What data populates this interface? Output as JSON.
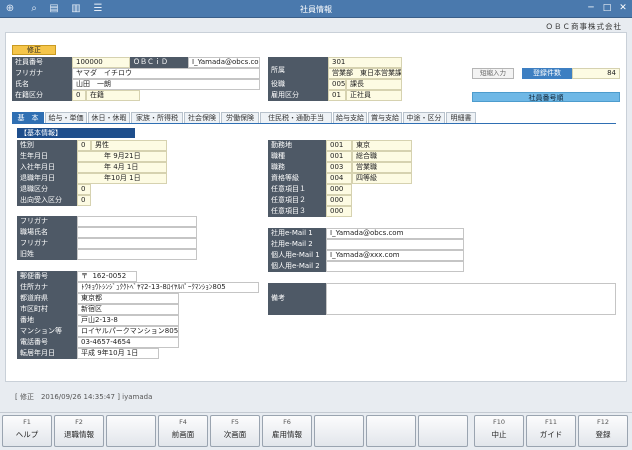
{
  "window": {
    "title": "社員情報",
    "company": "ＯＢＣ商事株式会社"
  },
  "mode": "修正",
  "top": {
    "emp_no_label": "社員番号",
    "emp_no": "100000",
    "obcid_label": "ＯＢＣｉＤ",
    "obcid": "I_Yamada@obcs.co",
    "furigana_label": "フリガナ",
    "furigana": "ヤマダ　イチロウ",
    "name_label": "氏名",
    "name": "山田　一朗",
    "status_label": "在籍区分",
    "status_code": "0",
    "status": "在籍",
    "dept_label": "所属",
    "dept_code": "301",
    "dept": "営業部　東日本営業課",
    "post_label": "役職",
    "post_code": "005",
    "post": "課長",
    "emp_type_label": "雇用区分",
    "emp_type_code": "01",
    "emp_type": "正社員",
    "short_input": "短縮入力",
    "reg_count_label": "登録件数",
    "reg_count": "84",
    "emp_order": "社員番号順"
  },
  "tabs": [
    "基　本",
    "給与・単価",
    "休日・休暇",
    "家族・所得税",
    "社会保険",
    "労働保険",
    "住民税・通勤手当",
    "給与支給",
    "賞与支給",
    "中途・区分",
    "明細書"
  ],
  "section_title": "【基本情報】",
  "left": {
    "gender_label": "性別",
    "gender_code": "0",
    "gender": "男性",
    "birth_label": "生年月日",
    "birth": "年  9月21日",
    "join_label": "入社年月日",
    "join": "年  4月  1日",
    "retire_label": "退職年月日",
    "retire": "年10月  1日",
    "retire_type_label": "退職区分",
    "retire_type": "0",
    "transfer_label": "出向受入区分",
    "transfer": "0",
    "furigana2_label": "フリガナ",
    "title_name_label": "職場氏名",
    "furigana3_label": "フリガナ",
    "old_name_label": "旧姓",
    "zip_label": "郵便番号",
    "zip_mark": "〒",
    "zip": "162-0052",
    "addr_kana_label": "住所カナ",
    "addr_kana": "ﾄｳｷｮｳﾄｼﾝｼﾞｭｸｸﾄﾍﾞﾔﾏ2-13-8ﾛｲﾔﾙﾊﾟｰｸﾏﾝｼｮﾝ805",
    "pref_label": "都道府県",
    "pref": "東京都",
    "city_label": "市区町村",
    "city": "新宿区",
    "block_label": "番地",
    "block": "戸山2-13-8",
    "bldg_label": "マンション等",
    "bldg": "ロイヤルパークマンション805",
    "tel_label": "電話番号",
    "tel": "03-4657-4654",
    "move_label": "転居年月日",
    "move": "平成  9年10月  1日"
  },
  "right": {
    "work_label": "勤務地",
    "work_code": "001",
    "work": "東京",
    "job_label": "職種",
    "job_code": "001",
    "job": "総合職",
    "duty_label": "職務",
    "duty_code": "003",
    "duty": "営業職",
    "grade_label": "資格等級",
    "grade_code": "004",
    "grade": "四等級",
    "opt1_label": "任意項目１",
    "opt1": "000",
    "opt2_label": "任意項目２",
    "opt2": "000",
    "opt3_label": "任意項目３",
    "opt3": "000",
    "mail1_label": "社用e-Mail 1",
    "mail1": "I_Yamada@obcs.com",
    "mail2_label": "社用e-Mail 2",
    "mail2": "",
    "pmail1_label": "個人用e-Mail 1",
    "pmail1": "I_Yamada@xxx.com",
    "pmail2_label": "個人用e-Mail 2",
    "pmail2": "",
    "note_label": "備考"
  },
  "status_line": "[ 修正　2016/09/26 14:35:47 ] iyamada",
  "fkeys": [
    {
      "k": "F1",
      "t": "ヘルプ"
    },
    {
      "k": "F2",
      "t": "退職情報"
    },
    {
      "k": "",
      "t": ""
    },
    {
      "k": "F4",
      "t": "前画面"
    },
    {
      "k": "F5",
      "t": "次画面"
    },
    {
      "k": "F6",
      "t": "雇用情報"
    },
    {
      "k": "",
      "t": ""
    },
    {
      "k": "",
      "t": ""
    },
    {
      "k": "",
      "t": ""
    },
    {
      "k": "F10",
      "t": "中止"
    },
    {
      "k": "F11",
      "t": "ガイド"
    },
    {
      "k": "F12",
      "t": "登録"
    }
  ]
}
